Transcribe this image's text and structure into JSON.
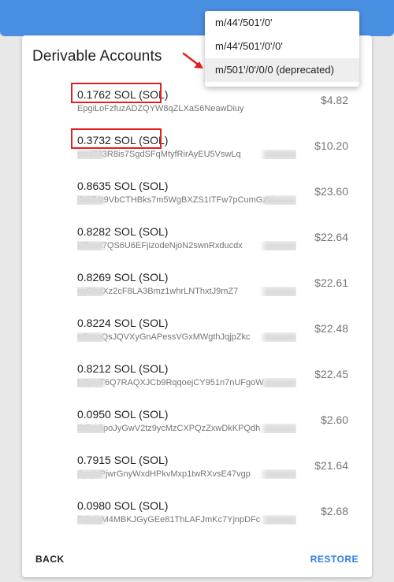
{
  "card": {
    "title": "Derivable Accounts"
  },
  "accounts": [
    {
      "balance": "0.1762 SOL (SOL)",
      "address": "EpgiLoFzfuzADZQYW8qZLXaS6NeawDiuy",
      "value": "$4.82",
      "highlighted": true
    },
    {
      "balance": "0.3732 SOL (SOL)",
      "address": "ssuj733R8is7SgdSFqMtyfRirAyEU5VswLq",
      "value": "$10.20",
      "highlighted": true
    },
    {
      "balance": "0.8635 SOL (SOL)",
      "address": "jDST4t9VbCTHBks7m5WgBXZS1ITFw7pCumGzV",
      "value": "$23.60",
      "highlighted": false
    },
    {
      "balance": "0.8282 SOL (SOL)",
      "address": "KPwet7QS6U6EFjizodeNjoN2swnRxducdx",
      "value": "$22.64",
      "highlighted": false
    },
    {
      "balance": "0.8269 SOL (SOL)",
      "address": "ggRbdXz2cF8LA3Bmz1whrLNThxtJ9mZ7",
      "value": "$22.61",
      "highlighted": false
    },
    {
      "balance": "0.8224 SOL (SOL)",
      "address": "eSzsoQsJQVXyGnAPessVGxMWgthJqjpZkc",
      "value": "$22.48",
      "highlighted": false
    },
    {
      "balance": "0.8212 SOL (SOL)",
      "address": "N7pUT6Q7RAQXJCb9RqqoejCY951n7nUFgoW",
      "value": "$22.45",
      "highlighted": false
    },
    {
      "balance": "0.0950 SOL (SOL)",
      "address": "FtCm6poJyGwV2tz9ycMzCXPQzZxwDkKPQdh",
      "value": "$2.60",
      "highlighted": false
    },
    {
      "balance": "0.7915 SOL (SOL)",
      "address": "AyzjHPjwrGnyWxdHPkvMxp1twRXvsE47vgp",
      "value": "$21.64",
      "highlighted": false
    },
    {
      "balance": "0.0980 SOL (SOL)",
      "address": "RQcigM4MBKJGyGEe81ThLAFJmKc7YjnpDFc",
      "value": "$2.68",
      "highlighted": false
    }
  ],
  "actions": {
    "back_label": "BACK",
    "restore_label": "RESTORE"
  },
  "derivation_menu": {
    "options": [
      {
        "label": "m/44'/501'/0'",
        "selected": false
      },
      {
        "label": "m/44'/501'/0'/0'",
        "selected": false
      },
      {
        "label": "m/501'/0'/0/0 (deprecated)",
        "selected": true
      }
    ]
  },
  "colors": {
    "header_bar": "#4a90e2",
    "highlight_box": "#e02020",
    "restore_button": "#2f7ee3"
  },
  "icons": {
    "annotation": "red-arrow-icon"
  }
}
